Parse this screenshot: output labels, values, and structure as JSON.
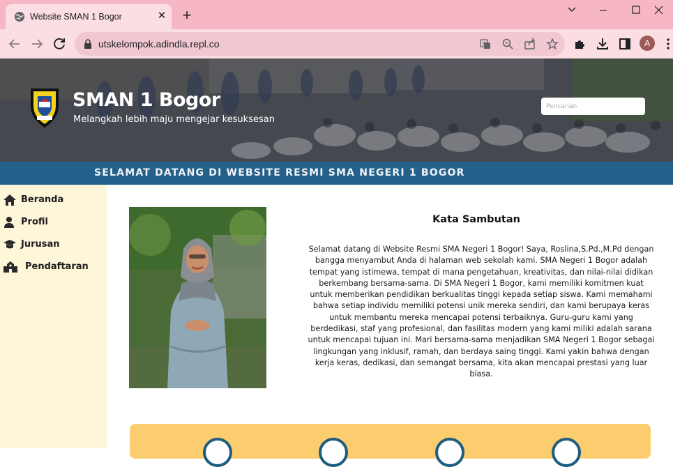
{
  "browser": {
    "tab_title": "Website SMAN 1 Bogor",
    "url": "utskelompok.adindla.repl.co",
    "profile_initial": "A"
  },
  "header": {
    "title": "SMAN 1 Bogor",
    "tagline": "Melangkah lebih maju mengejar kesuksesan",
    "search_placeholder": "Pencarian"
  },
  "banner": {
    "text": "SELAMAT DATANG DI WEBSITE RESMI SMA NEGERI 1 BOGOR"
  },
  "sidebar": {
    "items": [
      {
        "label": "Beranda",
        "icon": "home-icon"
      },
      {
        "label": "Profil",
        "icon": "user-icon"
      },
      {
        "label": "Jurusan",
        "icon": "graduation-cap-icon"
      },
      {
        "label": "Pendaftaran",
        "icon": "school-building-icon"
      }
    ]
  },
  "main": {
    "welcome_title": "Kata Sambutan",
    "welcome_body": "Selamat datang di Website Resmi SMA Negeri 1 Bogor! Saya, Roslina,S.Pd.,M.Pd dengan bangga menyambut Anda di halaman web sekolah kami. SMA Negeri 1 Bogor adalah tempat yang istimewa, tempat di mana pengetahuan, kreativitas, dan nilai-nilai didikan berkembang bersama-sama. Di SMA Negeri 1 Bogor, kami memiliki komitmen kuat untuk memberikan pendidikan berkualitas tinggi kepada setiap siswa. Kami memahami bahwa setiap individu memiliki potensi unik mereka sendiri, dan kami berupaya keras untuk membantu mereka mencapai potensi terbaiknya. Guru-guru kami yang berdedikasi, staf yang profesional, dan fasilitas modern yang kami miliki adalah sarana untuk mencapai tujuan ini. Mari bersama-sama menjadikan SMA Negeri 1 Bogor sebagai lingkungan yang inklusif, ramah, dan berdaya saing tinggi. Kami yakin bahwa dengan kerja keras, dedikasi, dan semangat bersama, kita akan mencapai prestasi yang luar biasa."
  },
  "colors": {
    "tabbar": "#f7b6c4",
    "banner": "#246089",
    "sidebar": "#fdf6d9",
    "features": "#fbcd6e"
  }
}
